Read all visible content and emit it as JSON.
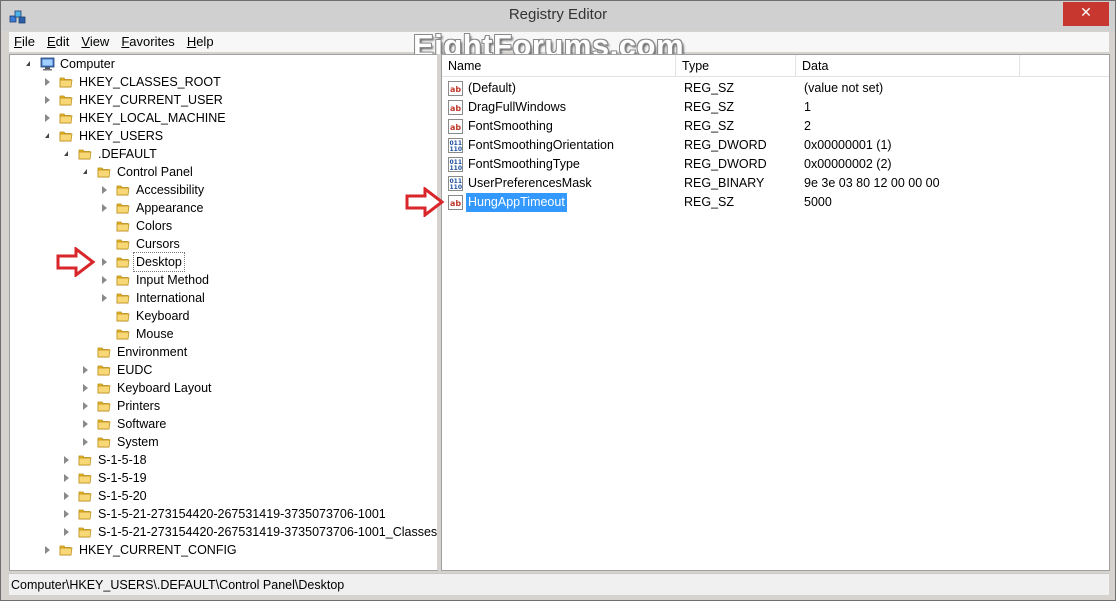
{
  "window": {
    "title": "Registry Editor",
    "close_glyph": "✕"
  },
  "watermark": "EightForums.com",
  "menu": [
    {
      "first": "F",
      "rest": "ile"
    },
    {
      "first": "E",
      "rest": "dit"
    },
    {
      "first": "V",
      "rest": "iew"
    },
    {
      "first": "F",
      "rest": "avorites",
      "underline_index": 1
    },
    {
      "first": "H",
      "rest": "elp"
    }
  ],
  "tree": [
    {
      "label": "Computer",
      "level": 0,
      "state": "open",
      "icon": "computer-icon"
    },
    {
      "label": "HKEY_CLASSES_ROOT",
      "level": 1,
      "state": "closed"
    },
    {
      "label": "HKEY_CURRENT_USER",
      "level": 1,
      "state": "closed"
    },
    {
      "label": "HKEY_LOCAL_MACHINE",
      "level": 1,
      "state": "closed"
    },
    {
      "label": "HKEY_USERS",
      "level": 1,
      "state": "open"
    },
    {
      "label": ".DEFAULT",
      "level": 2,
      "state": "open"
    },
    {
      "label": "Control Panel",
      "level": 3,
      "state": "open"
    },
    {
      "label": "Accessibility",
      "level": 4,
      "state": "closed"
    },
    {
      "label": "Appearance",
      "level": 4,
      "state": "closed"
    },
    {
      "label": "Colors",
      "level": 4,
      "state": "none"
    },
    {
      "label": "Cursors",
      "level": 4,
      "state": "none"
    },
    {
      "label": "Desktop",
      "level": 4,
      "state": "closed",
      "selected": true
    },
    {
      "label": "Input Method",
      "level": 4,
      "state": "closed"
    },
    {
      "label": "International",
      "level": 4,
      "state": "closed"
    },
    {
      "label": "Keyboard",
      "level": 4,
      "state": "none"
    },
    {
      "label": "Mouse",
      "level": 4,
      "state": "none"
    },
    {
      "label": "Environment",
      "level": 3,
      "state": "none"
    },
    {
      "label": "EUDC",
      "level": 3,
      "state": "closed"
    },
    {
      "label": "Keyboard Layout",
      "level": 3,
      "state": "closed"
    },
    {
      "label": "Printers",
      "level": 3,
      "state": "closed"
    },
    {
      "label": "Software",
      "level": 3,
      "state": "closed"
    },
    {
      "label": "System",
      "level": 3,
      "state": "closed"
    },
    {
      "label": "S-1-5-18",
      "level": 2,
      "state": "closed"
    },
    {
      "label": "S-1-5-19",
      "level": 2,
      "state": "closed"
    },
    {
      "label": "S-1-5-20",
      "level": 2,
      "state": "closed"
    },
    {
      "label": "S-1-5-21-273154420-267531419-3735073706-1001",
      "level": 2,
      "state": "closed"
    },
    {
      "label": "S-1-5-21-273154420-267531419-3735073706-1001_Classes",
      "level": 2,
      "state": "closed"
    },
    {
      "label": "HKEY_CURRENT_CONFIG",
      "level": 1,
      "state": "closed"
    }
  ],
  "columns": {
    "name": "Name",
    "type": "Type",
    "data": "Data"
  },
  "values": [
    {
      "name": "(Default)",
      "type": "REG_SZ",
      "data": "(value not set)",
      "icon": "string-value-icon"
    },
    {
      "name": "DragFullWindows",
      "type": "REG_SZ",
      "data": "1",
      "icon": "string-value-icon"
    },
    {
      "name": "FontSmoothing",
      "type": "REG_SZ",
      "data": "2",
      "icon": "string-value-icon"
    },
    {
      "name": "FontSmoothingOrientation",
      "type": "REG_DWORD",
      "data": "0x00000001 (1)",
      "icon": "binary-value-icon"
    },
    {
      "name": "FontSmoothingType",
      "type": "REG_DWORD",
      "data": "0x00000002 (2)",
      "icon": "binary-value-icon"
    },
    {
      "name": "UserPreferencesMask",
      "type": "REG_BINARY",
      "data": "9e 3e 03 80 12 00 00 00",
      "icon": "binary-value-icon"
    },
    {
      "name": "HungAppTimeout",
      "type": "REG_SZ",
      "data": "5000",
      "icon": "string-value-icon",
      "selected": true
    }
  ],
  "status": "Computer\\HKEY_USERS\\.DEFAULT\\Control Panel\\Desktop",
  "colors": {
    "accent": "#3399ff",
    "arrow": "#d9262a",
    "close": "#c7372f",
    "folder": "#f2c94c"
  }
}
